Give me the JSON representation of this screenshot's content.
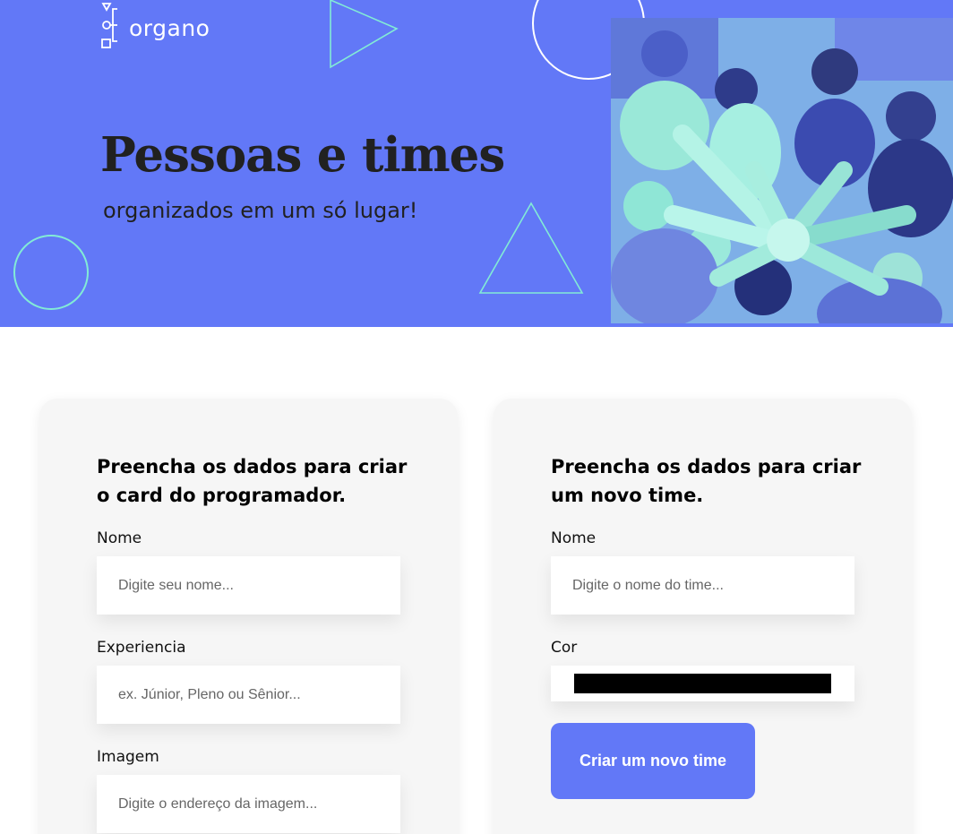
{
  "brand": {
    "name": "organo"
  },
  "hero": {
    "title": "Pessoas e times",
    "subtitle": "organizados em um só lugar!",
    "image_alt": "Pessoas com as mãos unidas"
  },
  "colors": {
    "primary": "#6278f7",
    "accent": "#82ebd6",
    "card_bg": "#f6f6f6",
    "text": "#212121",
    "team_color": "#000000"
  },
  "form_person": {
    "title": "Preencha os dados para criar o card do programador.",
    "fields": [
      {
        "label": "Nome",
        "placeholder": "Digite seu nome...",
        "value": ""
      },
      {
        "label": "Experiencia",
        "placeholder": "ex. Júnior, Pleno ou Sênior...",
        "value": ""
      },
      {
        "label": "Imagem",
        "placeholder": "Digite o endereço da imagem...",
        "value": ""
      }
    ]
  },
  "form_team": {
    "title": "Preencha os dados para criar um novo time.",
    "name_field": {
      "label": "Nome",
      "placeholder": "Digite o nome do time...",
      "value": ""
    },
    "color_field": {
      "label": "Cor",
      "value": "#000000"
    },
    "submit_label": "Criar um novo time"
  }
}
